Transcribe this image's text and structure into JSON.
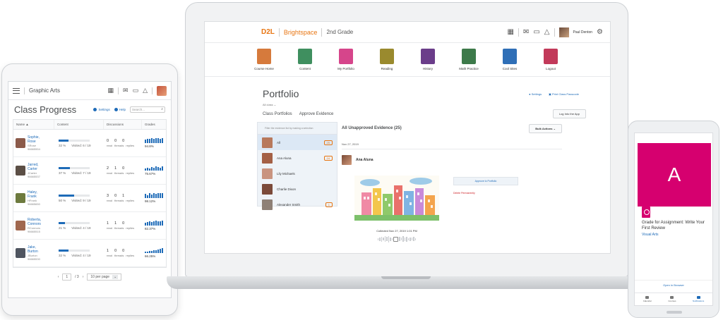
{
  "tablet": {
    "course_name": "Graphic Arts",
    "page_title": "Class Progress",
    "settings_label": "Settings",
    "help_label": "Help",
    "search_placeholder": "Search...",
    "columns": [
      "Name ▲",
      "Content",
      "Discussions",
      "Grades"
    ],
    "discussion_labels": [
      "read",
      "threads",
      "replies"
    ],
    "rows": [
      {
        "first": "Sophie,",
        "last": "Rose",
        "user": "SRose",
        "id": "96665554",
        "content_pct": "32 %",
        "content_progress": 0.32,
        "visited": "Visited: 6 / 19",
        "read": "0",
        "threads": "0",
        "replies": "0",
        "grade": "94.8%",
        "photo_color": "#8b5a4a"
      },
      {
        "first": "Jarred,",
        "last": "Carter",
        "user": "JCarter",
        "id": "96665537",
        "content_pct": "37 %",
        "content_progress": 0.37,
        "visited": "Visited: 7 / 19",
        "read": "2",
        "threads": "1",
        "replies": "0",
        "grade": "75.67%",
        "photo_color": "#5b4e45"
      },
      {
        "first": "Haley,",
        "last": "Frank",
        "user": "HFrank",
        "id": "96665650",
        "content_pct": "50 %",
        "content_progress": 0.5,
        "visited": "Visited: 9 / 19",
        "read": "3",
        "threads": "0",
        "replies": "1",
        "grade": "98.12%",
        "photo_color": "#6d7a3e"
      },
      {
        "first": "Roberta,",
        "last": "Connors",
        "user": "RConnors",
        "id": "96665515",
        "content_pct": "21 %",
        "content_progress": 0.21,
        "visited": "Visited: 4 / 19",
        "read": "1",
        "threads": "1",
        "replies": "0",
        "grade": "82.37%",
        "photo_color": "#a0674e"
      },
      {
        "first": "Jake,",
        "last": "Burton",
        "user": "JBurton",
        "id": "96665530",
        "content_pct": "32 %",
        "content_progress": 0.32,
        "visited": "Visited: 4 / 19",
        "read": "1",
        "threads": "0",
        "replies": "0",
        "grade": "66.25%",
        "photo_color": "#4f5560"
      }
    ],
    "pager": {
      "current": "1",
      "total": "/ 3",
      "per_page": "10 per page"
    }
  },
  "laptop": {
    "brand_d2l": "D2L",
    "brand_product": "Brightspace",
    "course": "2nd Grade",
    "user_name": "Paul Denton",
    "nav": [
      {
        "label": "Course Home",
        "color": "#d67a3c"
      },
      {
        "label": "Content",
        "color": "#3f8f5f"
      },
      {
        "label": "My Portfolio",
        "color": "#d6458b"
      },
      {
        "label": "Reading",
        "color": "#9a8a2e"
      },
      {
        "label": "History",
        "color": "#6b3d8a"
      },
      {
        "label": "Math Practice",
        "color": "#3d7a4a"
      },
      {
        "label": "Cool Sites",
        "color": "#2f6fb7"
      },
      {
        "label": "Logout",
        "color": "#c23a5a"
      }
    ],
    "title": "Portfolio",
    "subtitle": "All class",
    "settings_link": "Settings",
    "print_link": "Print Class Passcode",
    "tabs": [
      "Class Portfolios",
      "Approve Evidence"
    ],
    "evaluate_button": "Log Into the App",
    "filter_hint": "Filter the evidence list by making a selection",
    "filter_items": [
      {
        "name": "All",
        "count": "25",
        "photo_color": "#b8795c"
      },
      {
        "name": "Ana Aluna",
        "count": "24",
        "photo_color": "#a46045"
      },
      {
        "name": "Lily Michaels",
        "count": "",
        "photo_color": "#c99480"
      },
      {
        "name": "Charlie Dixon",
        "count": "",
        "photo_color": "#7b4a3a"
      },
      {
        "name": "Alexander Smith",
        "count": "1",
        "photo_color": "#8e8076"
      }
    ],
    "evidence_heading": "All Unapproved Evidence (25)",
    "bulk_actions": "Bulk Actions",
    "evidence_date": "Nov 27, 2019",
    "evidence_user": "Ana Aluna",
    "evidence_caption": "Collected Nov 27, 2019 1:01 PM",
    "approve_button": "Approve to Portfolio",
    "delete_link": "Delete Permanently"
  },
  "phone": {
    "card_letter": "A",
    "grade_title": "Grade for Assignment: Write Your First Review",
    "course": "Visual Arts",
    "open_browser": "Open in Browser",
    "tabs": [
      "Calendar",
      "Courses",
      "Notifications"
    ]
  }
}
